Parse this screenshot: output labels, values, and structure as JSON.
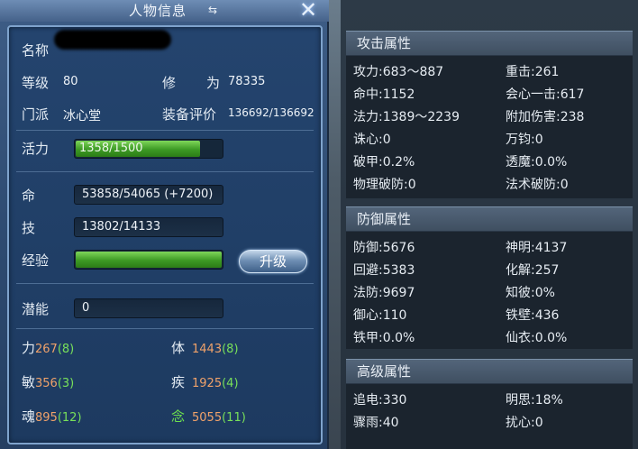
{
  "window": {
    "title": "人物信息",
    "close_icon": "close-icon",
    "title_icon": "swap-icon"
  },
  "profile": {
    "name_label": "名称",
    "level_label": "等级",
    "level_value": "80",
    "cultivation_label_1": "修",
    "cultivation_label_2": "为",
    "cultivation_value": "78335",
    "sect_label": "门派",
    "sect_value": "冰心堂",
    "equip_label": "装备评价",
    "equip_value": "136692/136692",
    "vitality_label": "活力",
    "vitality_text": "1358/1500",
    "vitality_fraction": 0.905,
    "hp_label": "命",
    "hp_value": "53858/54065 (+7200)",
    "skill_label": "技",
    "skill_value": "13802/14133",
    "exp_label": "经验",
    "exp_fraction": 1.0,
    "upgrade_button": "升级",
    "potential_label": "潜能",
    "potential_value": "0"
  },
  "stats": [
    {
      "label": "力",
      "base": "267",
      "bonus": "(8)"
    },
    {
      "label": "体",
      "base": "1443",
      "bonus": "(8)"
    },
    {
      "label": "敏",
      "base": "356",
      "bonus": "(3)"
    },
    {
      "label": "疾",
      "base": "1925",
      "bonus": "(4)"
    },
    {
      "label": "魂",
      "base": "895",
      "bonus": "(12)"
    },
    {
      "label": "念",
      "base": "5055",
      "bonus": "(11)"
    }
  ],
  "attack": {
    "header": "攻击属性",
    "items": [
      "攻力:683～887",
      "重击:261",
      "命中:1152",
      "会心一击:617",
      "法力:1389～2239",
      "附加伤害:238",
      "诛心:0",
      "万钧:0",
      "破甲:0.2%",
      "透魔:0.0%",
      "物理破防:0",
      "法术破防:0"
    ]
  },
  "defense": {
    "header": "防御属性",
    "items": [
      "防御:5676",
      "神明:4137",
      "回避:5383",
      "化解:257",
      "法防:9697",
      "知彼:0%",
      "御心:110",
      "铁壁:436",
      "铁甲:0.0%",
      "仙衣:0.0%"
    ]
  },
  "advanced": {
    "header": "高级属性",
    "items": [
      "追电:330",
      "明思:18%",
      "骤雨:40",
      "扰心:0"
    ]
  },
  "colors": {
    "stat_base": "#f0a26a",
    "stat_bonus": "#78e05a",
    "bar_green": "#3c9a24"
  }
}
